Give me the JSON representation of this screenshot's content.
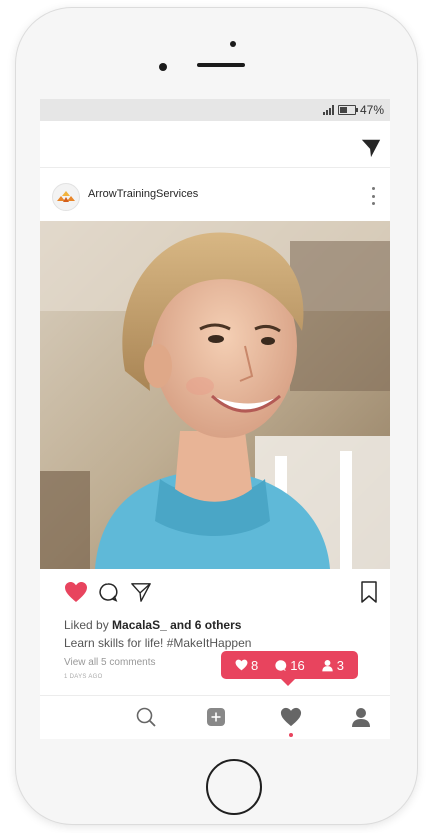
{
  "status_bar": {
    "battery": "47%",
    "battery_level": 0.47
  },
  "post": {
    "username": "ArrowTrainingServices",
    "liked_prefix": "Liked by",
    "liked_user": "MacalaS_",
    "liked_suffix": "and 6 others",
    "caption": "Learn skills for life! #MakeItHappen",
    "comments_link": "View all 5 comments",
    "timestamp": "1 DAYS AGO"
  },
  "notification": {
    "likes": "8",
    "comments": "16",
    "followers": "3"
  },
  "colors": {
    "accent": "#e8445e",
    "text": "#262626",
    "muted": "#999999",
    "status_bar": "#e6e6e6"
  },
  "icons": [
    "send-icon",
    "more-icon",
    "heart-icon",
    "comment-icon",
    "share-icon",
    "bookmark-icon",
    "home-search-icon",
    "add-icon",
    "activity-icon",
    "profile-icon"
  ]
}
